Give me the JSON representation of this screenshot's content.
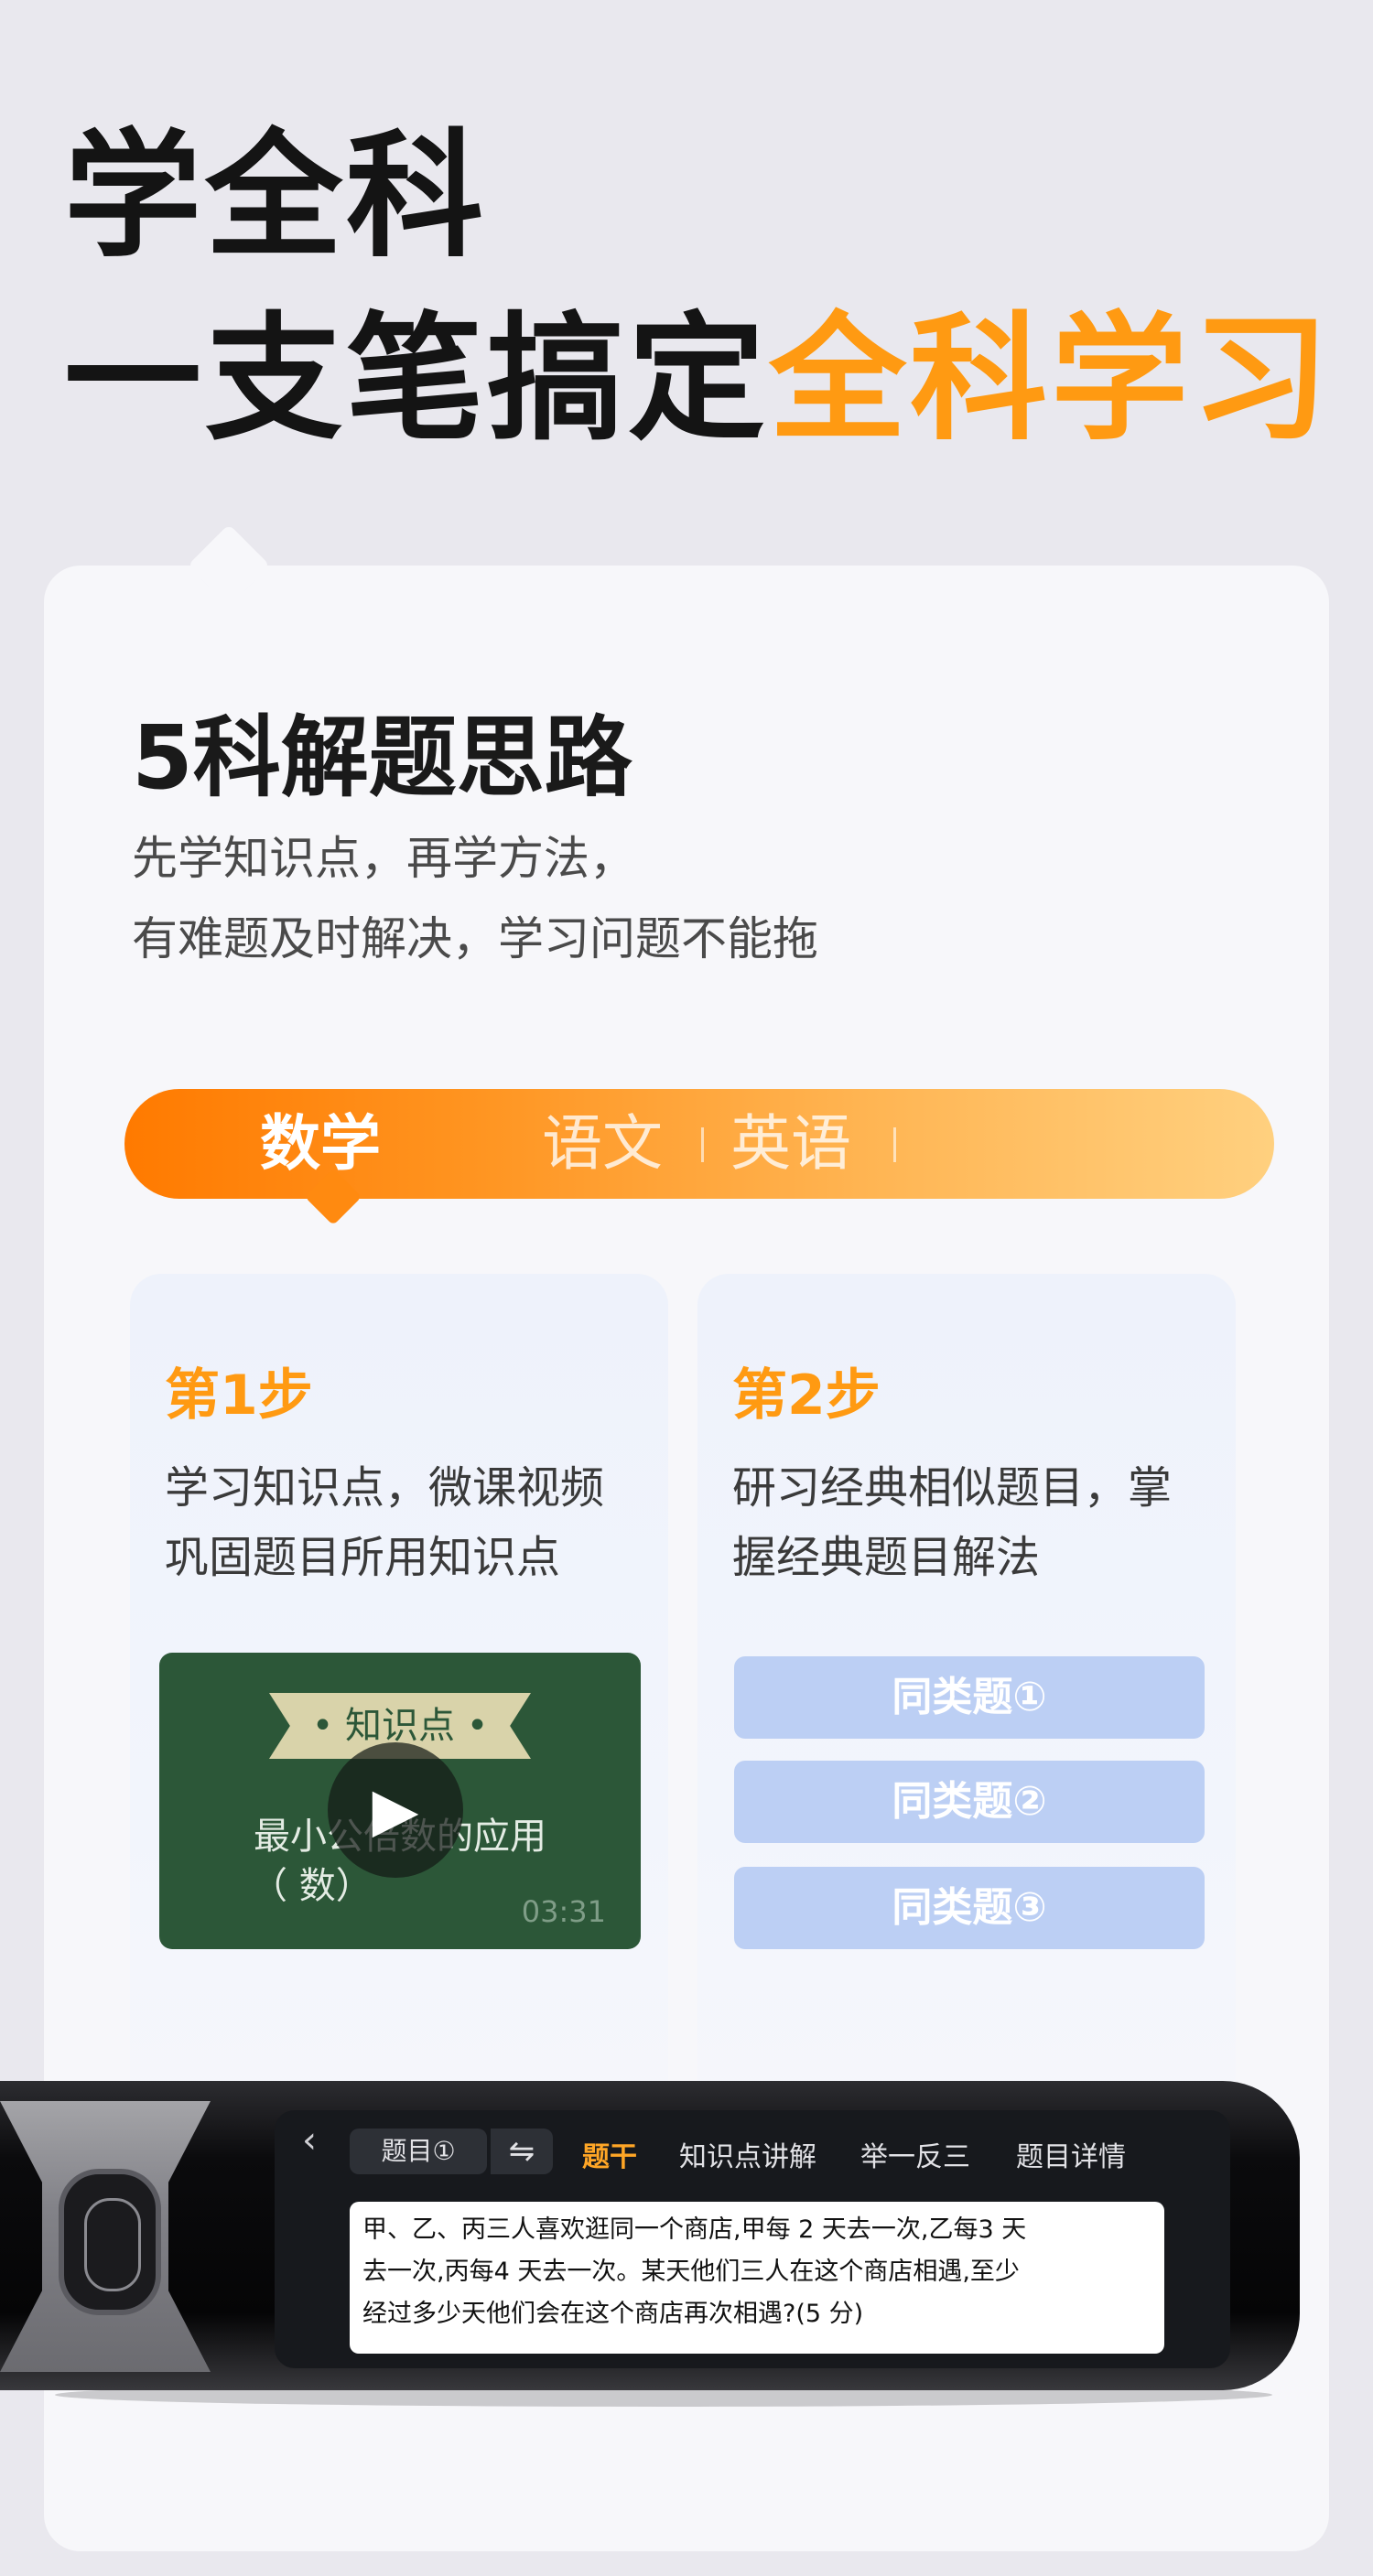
{
  "hero": {
    "line1": "学全科",
    "line2_prefix": "一支笔搞定",
    "line2_accent": "全科学习"
  },
  "section": {
    "title": "5科解题思路",
    "desc_line1": "先学知识点，再学方法，",
    "desc_line2": "有难题及时解决，学习问题不能拖"
  },
  "tabs": {
    "active": "数学",
    "items": [
      "语文",
      "英语"
    ]
  },
  "step1": {
    "title": "第1步",
    "desc_line1": "学习知识点，微课视频",
    "desc_line2": "巩固题目所用知识点",
    "video": {
      "ribbon": "• 知识点 •",
      "title": "最小公倍数的应用",
      "subtitle": "（   数）",
      "duration": "03:31",
      "play_icon": "▶"
    }
  },
  "step2": {
    "title": "第2步",
    "desc_line1": "研习经典相似题目，掌",
    "desc_line2": "握经典题目解法",
    "buttons": [
      "同类题①",
      "同类题②",
      "同类题③"
    ]
  },
  "device": {
    "back_icon": "‹",
    "chip": "题目①",
    "swap_icon": "⇋",
    "tabs": [
      "题干",
      "知识点讲解",
      "举一反三",
      "题目详情"
    ],
    "question_line1": "甲、乙、丙三人喜欢逛同一个商店,甲每 2 天去一次,乙每3 天",
    "question_line2": "去一次,丙每4 天去一次。某天他们三人在这个商店相遇,至少",
    "question_line3": "经过多少天他们会在这个商店再次相遇?(5 分)"
  },
  "colors": {
    "accent": "#ff9a12",
    "tab_gradient_start": "#ff7a00",
    "tab_gradient_end": "#ffd07f",
    "video_bg": "#2c5738",
    "similar_button": "#bccff4"
  }
}
